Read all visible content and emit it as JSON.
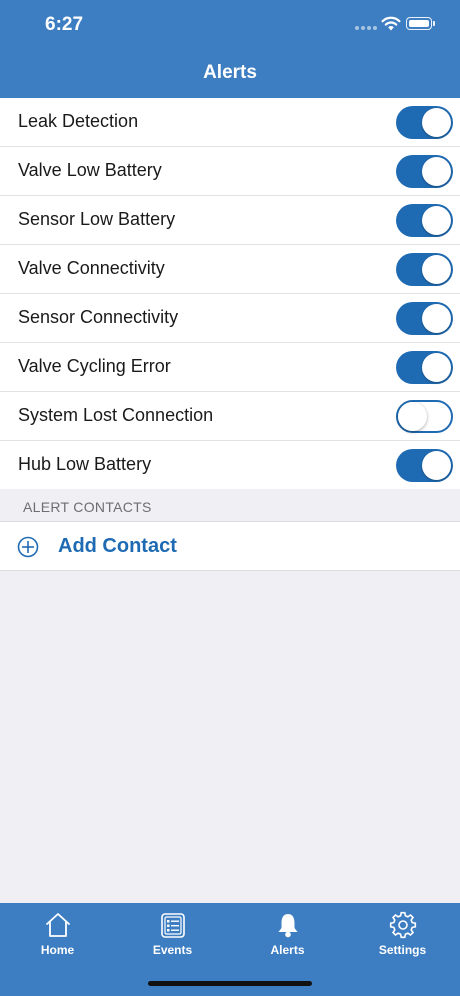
{
  "status_bar": {
    "time": "6:27"
  },
  "nav": {
    "title": "Alerts"
  },
  "alerts": [
    {
      "label": "Leak Detection",
      "enabled": true
    },
    {
      "label": "Valve Low Battery",
      "enabled": true
    },
    {
      "label": "Sensor Low Battery",
      "enabled": true
    },
    {
      "label": "Valve Connectivity",
      "enabled": true
    },
    {
      "label": "Sensor Connectivity",
      "enabled": true
    },
    {
      "label": "Valve Cycling Error",
      "enabled": true
    },
    {
      "label": "System Lost Connection",
      "enabled": false
    },
    {
      "label": "Hub Low Battery",
      "enabled": true
    }
  ],
  "contacts_section": {
    "header": "ALERT CONTACTS",
    "add_label": "Add Contact",
    "add_icon": "plus-circle-icon"
  },
  "tabbar": {
    "tabs": [
      {
        "label": "Home",
        "icon": "home-icon"
      },
      {
        "label": "Events",
        "icon": "events-list-icon"
      },
      {
        "label": "Alerts",
        "icon": "bell-icon"
      },
      {
        "label": "Settings",
        "icon": "gear-icon"
      }
    ],
    "selected": "Alerts"
  },
  "colors": {
    "header_blue": "#3d7dc1",
    "accent_blue": "#1f6bb3",
    "background": "#efeff4"
  }
}
